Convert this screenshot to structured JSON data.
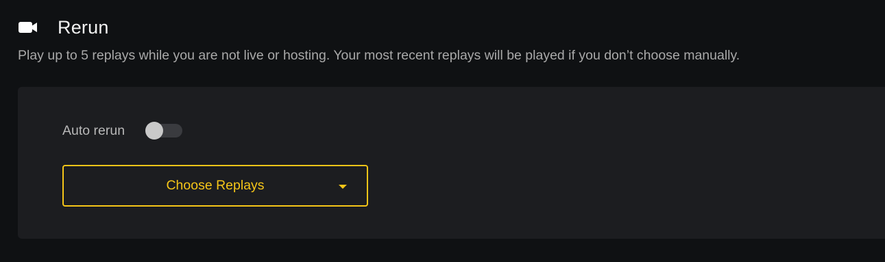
{
  "section": {
    "icon": "video-camera-icon",
    "title": "Rerun",
    "description": "Play up to 5 replays while you are not live or hosting. Your most recent replays will be played if you don’t choose manually."
  },
  "auto_rerun": {
    "label": "Auto rerun",
    "enabled": false
  },
  "choose_replays": {
    "label": "Choose Replays",
    "icon": "caret-down-icon"
  },
  "colors": {
    "background": "#0f1113",
    "panel": "#1c1d20",
    "accent": "#f5c518"
  }
}
